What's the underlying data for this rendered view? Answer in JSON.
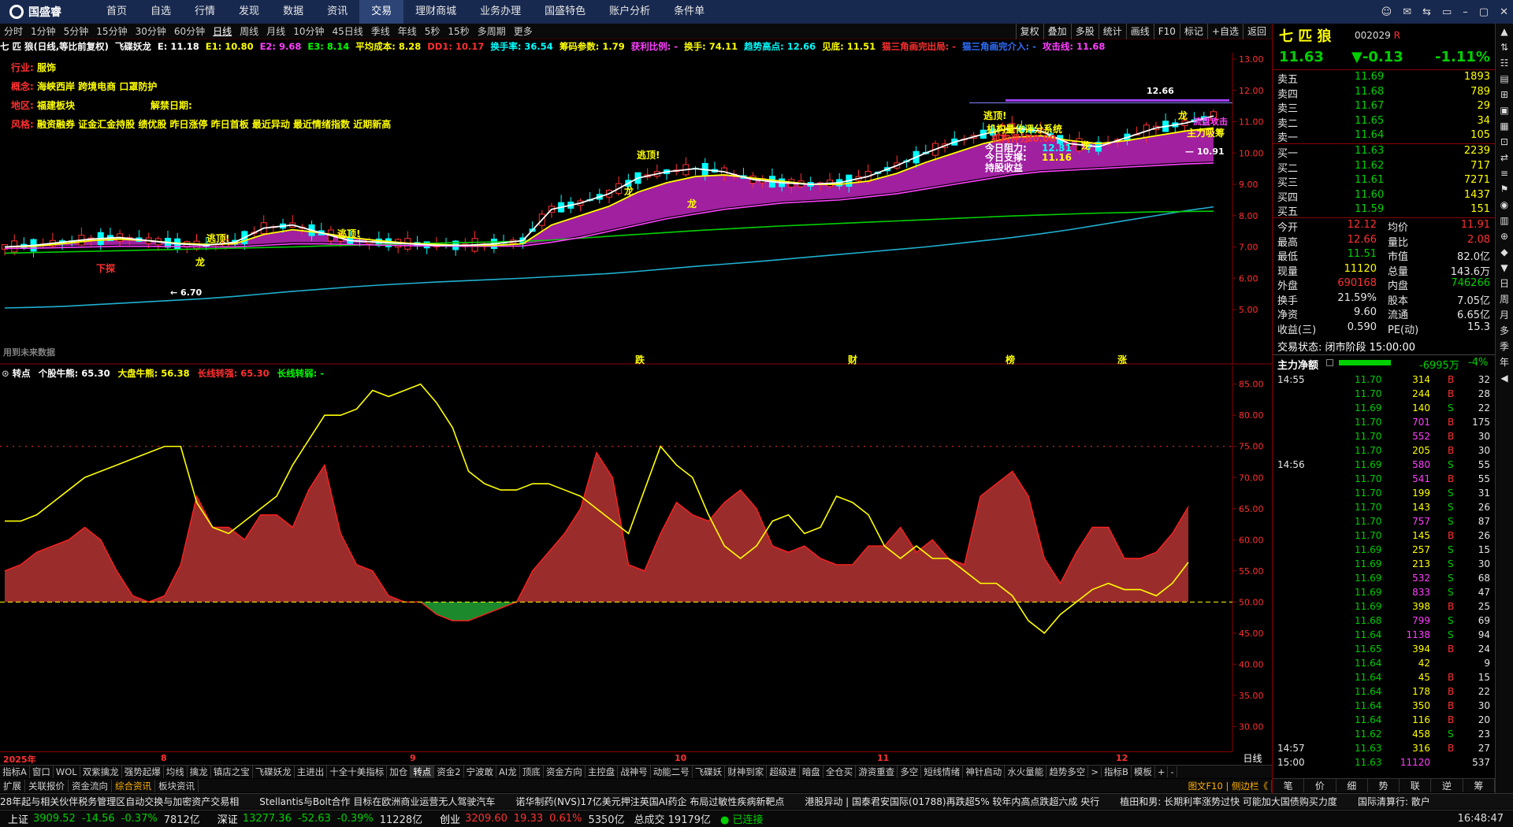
{
  "app": {
    "logo": "国盛睿"
  },
  "topnav": [
    "首页",
    "自选",
    "行情",
    "发现",
    "数据",
    "资讯",
    "交易",
    "理财商城",
    "业务办理",
    "国盛特色",
    "账户分析",
    "条件单"
  ],
  "topnav_active": 6,
  "window_controls": [
    "☺",
    "✉",
    "⇆",
    "▭",
    "–",
    "▢",
    "✕"
  ],
  "periods": [
    "分时",
    "1分钟",
    "5分钟",
    "15分钟",
    "30分钟",
    "60分钟",
    "日线",
    "周线",
    "月线",
    "10分钟",
    "45日线",
    "季线",
    "年线",
    "5秒",
    "15秒",
    "多周期",
    "更多"
  ],
  "period_active": 6,
  "right_tools": [
    "复权",
    "叠加",
    "多股",
    "统计",
    "画线",
    "F10",
    "标记",
    "+自选",
    "返回"
  ],
  "indicators": [
    {
      "t": "七 匹 狼(日线,等比前复权)",
      "c": "#ffffff"
    },
    {
      "t": "飞碟妖龙",
      "c": "#ffffff"
    },
    {
      "t": "E: 11.18",
      "c": "#ffffff"
    },
    {
      "t": "E1: 10.80",
      "c": "#ffff00"
    },
    {
      "t": "E2: 9.68",
      "c": "#ff40ff"
    },
    {
      "t": "E3: 8.14",
      "c": "#00ff00"
    },
    {
      "t": "平均成本: 8.28",
      "c": "#ffff00"
    },
    {
      "t": "DD1: 10.17",
      "c": "#ff3030"
    },
    {
      "t": "换手率: 36.54",
      "c": "#00ffff"
    },
    {
      "t": "筹码参数: 1.79",
      "c": "#ffff00"
    },
    {
      "t": "获利比例: -",
      "c": "#ff40ff"
    },
    {
      "t": "换手: 74.11",
      "c": "#ffff00"
    },
    {
      "t": "趋势高点: 12.66",
      "c": "#00ffff"
    },
    {
      "t": "见底: 11.51",
      "c": "#ffff00"
    },
    {
      "t": "猫三角画完出局: -",
      "c": "#ff3030"
    },
    {
      "t": "猫三角画完介入: -",
      "c": "#3070ff"
    },
    {
      "t": "攻击线: 11.68",
      "c": "#ff40ff"
    }
  ],
  "info": [
    {
      "k": "行业:",
      "v": "服饰"
    },
    {
      "k": "概念:",
      "v": "海峡西岸 跨境电商 口罩防护"
    },
    {
      "k": "地区:",
      "v": "福建板块",
      "k2": "解禁日期:"
    },
    {
      "k": "风格:",
      "v": "融资融券 证金汇金持股 绩优股 昨日涨停 昨日首板 最近异动 最近情绪指数 近期新高"
    }
  ],
  "main_axis": [
    "13.00",
    "12.00",
    "11.00",
    "10.00",
    "9.00",
    "8.00",
    "7.00",
    "6.00",
    "5.00"
  ],
  "chart_annotations": {
    "high": "12.66",
    "low": "6.70",
    "last": "10.91",
    "flag": "下探",
    "escape": "逃顶!",
    "dragon": "龙",
    "main_buy": "主力吸筹",
    "rating": "机构量化评分系统",
    "score_label": "机构评分:",
    "score": "70.00",
    "today_res": "今日阻力:",
    "today_res_v": "12.31",
    "today_sup": "今日支撑:",
    "today_sup_v": "11.16",
    "hold": "持股收益",
    "future": "用到未来数据",
    "tags": [
      "跌",
      "财",
      "榜",
      "涨"
    ],
    "rd": "流盘攻击"
  },
  "sub_title": [
    {
      "t": "转点",
      "c": "#ffffff"
    },
    {
      "t": "个股牛熊: 65.30",
      "c": "#ffffff"
    },
    {
      "t": "大盘牛熊: 56.38",
      "c": "#ffff00"
    },
    {
      "t": "长线转强: 65.30",
      "c": "#ff3030"
    },
    {
      "t": "长线转弱: -",
      "c": "#00ff00"
    }
  ],
  "sub_axis": [
    "85.00",
    "80.00",
    "75.00",
    "70.00",
    "65.00",
    "60.00",
    "55.00",
    "50.00",
    "45.00",
    "40.00",
    "35.00",
    "30.00"
  ],
  "xaxis": [
    {
      "t": "2025年",
      "x": 4
    },
    {
      "t": "8",
      "x": 204
    },
    {
      "t": "9",
      "x": 520
    },
    {
      "t": "10",
      "x": 856
    },
    {
      "t": "11",
      "x": 1113
    },
    {
      "t": "12",
      "x": 1416
    }
  ],
  "riqi": "日线",
  "tabs1": [
    "指标A",
    "窗口",
    "WOL",
    "双紫擒龙",
    "强势起爆",
    "均线",
    "擒龙",
    "镇店之宝",
    "飞碟妖龙",
    "主进出",
    "十全十美指标",
    "加仓",
    "转点",
    "资金2",
    "宁波敢",
    "AI龙",
    "顶底",
    "资金方向",
    "主控盘",
    "战神号",
    "动能二号",
    "飞碟妖",
    "财神到家",
    "超级进",
    "暗盘",
    "全仓买",
    "游资重查",
    "多空",
    "短线情绪",
    "神针启动",
    "水火量能",
    "趋势多空",
    ">",
    "指标B",
    "模板",
    "+",
    "-"
  ],
  "tabs1_active": 12,
  "tabs2": [
    "扩展",
    "关联报价",
    "资金流向",
    "综合资讯",
    "板块资讯"
  ],
  "tabs2_active": 3,
  "tabs2_right": "图文F10 | 侧边栏《",
  "news": [
    "28年起与相关伙伴税务管理区自动交换与加密资产交易相",
    "Stellantis与Bolt合作 目标在欧洲商业运营无人驾驶汽车",
    "诺华制药(NVS)17亿美元押注英国AI药企 布局过敏性疾病新靶点",
    "港股异动 | 国泰君安国际(01788)再跌超5% 较年内高点跌超六成 央行",
    "植田和男: 长期利率涨势过快 可能加大国债购买力度",
    "国际清算行: 散户"
  ],
  "status": [
    {
      "n": "上证",
      "v": "3909.52",
      "d": "-14.56",
      "p": "-0.37%",
      "a": "7812亿",
      "c": "g"
    },
    {
      "n": "深证",
      "v": "13277.36",
      "d": "-52.63",
      "p": "-0.39%",
      "a": "11228亿",
      "c": "g"
    },
    {
      "n": "创业",
      "v": "3209.60",
      "d": "19.33",
      "p": "0.61%",
      "a": "5350亿",
      "c": "r"
    }
  ],
  "status_total": "总成交 19179亿",
  "status_conn": "已连接",
  "status_time": "16:48:47",
  "stock": {
    "name": "七 匹 狼",
    "code": "002029",
    "tag": "R",
    "price": "11.63",
    "change": "▼-0.13",
    "pct": "-1.11%"
  },
  "asks": [
    {
      "l": "卖五",
      "p": "11.69",
      "v": "1893"
    },
    {
      "l": "卖四",
      "p": "11.68",
      "v": "789"
    },
    {
      "l": "卖三",
      "p": "11.67",
      "v": "29"
    },
    {
      "l": "卖二",
      "p": "11.65",
      "v": "34"
    },
    {
      "l": "卖一",
      "p": "11.64",
      "v": "105"
    }
  ],
  "bids": [
    {
      "l": "买一",
      "p": "11.63",
      "v": "2239"
    },
    {
      "l": "买二",
      "p": "11.62",
      "v": "717"
    },
    {
      "l": "买三",
      "p": "11.61",
      "v": "7271"
    },
    {
      "l": "买四",
      "p": "11.60",
      "v": "1437"
    },
    {
      "l": "买五",
      "p": "11.59",
      "v": "151"
    }
  ],
  "stats": [
    {
      "l": "今开",
      "v": "12.12",
      "c": "r",
      "l2": "均价",
      "v2": "11.91",
      "c2": "r"
    },
    {
      "l": "最高",
      "v": "12.66",
      "c": "r",
      "l2": "量比",
      "v2": "2.08",
      "c2": "r"
    },
    {
      "l": "最低",
      "v": "11.51",
      "c": "g",
      "l2": "市值",
      "v2": "82.0亿",
      "c2": "w"
    },
    {
      "l": "现量",
      "v": "11120",
      "c": "y",
      "l2": "总量",
      "v2": "143.6万",
      "c2": "w"
    },
    {
      "l": "外盘",
      "v": "690168",
      "c": "r",
      "l2": "内盘",
      "v2": "746266",
      "c2": "g"
    },
    {
      "l": "换手",
      "v": "21.59%",
      "c": "w",
      "l2": "股本",
      "v2": "7.05亿",
      "c2": "w"
    },
    {
      "l": "净资",
      "v": "9.60",
      "c": "w",
      "l2": "流通",
      "v2": "6.65亿",
      "c2": "w"
    },
    {
      "l": "收益(三)",
      "v": "0.590",
      "c": "w",
      "l2": "PE(动)",
      "v2": "15.3",
      "c2": "w"
    }
  ],
  "trade_state": "交易状态: 闭市阶段 15:00:00",
  "main_net": {
    "l": "主力净额",
    "v": "-6995万",
    "p": "-4%",
    "fill": 0.8
  },
  "ticks": [
    {
      "t": "14:55",
      "p": "11.70",
      "v": "314",
      "s": "B",
      "n": "32"
    },
    {
      "t": "",
      "p": "11.70",
      "v": "244",
      "s": "B",
      "n": "28"
    },
    {
      "t": "",
      "p": "11.69",
      "v": "140",
      "s": "S",
      "n": "22"
    },
    {
      "t": "",
      "p": "11.70",
      "v": "701",
      "s": "B",
      "n": "175"
    },
    {
      "t": "",
      "p": "11.70",
      "v": "552",
      "s": "B",
      "n": "30"
    },
    {
      "t": "",
      "p": "11.70",
      "v": "205",
      "s": "B",
      "n": "30"
    },
    {
      "t": "14:56",
      "p": "11.69",
      "v": "580",
      "s": "S",
      "n": "55"
    },
    {
      "t": "",
      "p": "11.70",
      "v": "541",
      "s": "B",
      "n": "55"
    },
    {
      "t": "",
      "p": "11.70",
      "v": "199",
      "s": "S",
      "n": "31"
    },
    {
      "t": "",
      "p": "11.70",
      "v": "143",
      "s": "S",
      "n": "26"
    },
    {
      "t": "",
      "p": "11.70",
      "v": "757",
      "s": "S",
      "n": "87"
    },
    {
      "t": "",
      "p": "11.70",
      "v": "145",
      "s": "B",
      "n": "26"
    },
    {
      "t": "",
      "p": "11.69",
      "v": "257",
      "s": "S",
      "n": "15"
    },
    {
      "t": "",
      "p": "11.69",
      "v": "213",
      "s": "S",
      "n": "30"
    },
    {
      "t": "",
      "p": "11.69",
      "v": "532",
      "s": "S",
      "n": "68"
    },
    {
      "t": "",
      "p": "11.69",
      "v": "833",
      "s": "S",
      "n": "47"
    },
    {
      "t": "",
      "p": "11.69",
      "v": "398",
      "s": "B",
      "n": "25"
    },
    {
      "t": "",
      "p": "11.68",
      "v": "799",
      "s": "S",
      "n": "69"
    },
    {
      "t": "",
      "p": "11.64",
      "v": "1138",
      "s": "S",
      "n": "94"
    },
    {
      "t": "",
      "p": "11.65",
      "v": "394",
      "s": "B",
      "n": "24"
    },
    {
      "t": "",
      "p": "11.64",
      "v": "42",
      "s": "",
      "n": "9"
    },
    {
      "t": "",
      "p": "11.64",
      "v": "45",
      "s": "B",
      "n": "15"
    },
    {
      "t": "",
      "p": "11.64",
      "v": "178",
      "s": "B",
      "n": "22"
    },
    {
      "t": "",
      "p": "11.64",
      "v": "350",
      "s": "B",
      "n": "30"
    },
    {
      "t": "",
      "p": "11.64",
      "v": "116",
      "s": "B",
      "n": "20"
    },
    {
      "t": "",
      "p": "11.62",
      "v": "458",
      "s": "S",
      "n": "23"
    },
    {
      "t": "14:57",
      "p": "11.63",
      "v": "316",
      "s": "B",
      "n": "27"
    },
    {
      "t": "15:00",
      "p": "11.63",
      "v": "11120",
      "s": "",
      "n": "537"
    }
  ],
  "right_bottom_tabs": [
    "笔",
    "价",
    "细",
    "势",
    "联",
    "逆",
    "筹"
  ],
  "side_tabs": [
    "▲",
    "⇅",
    "☷",
    "▤",
    "⊞",
    "▣",
    "▦",
    "⊡",
    "⇄",
    "≡",
    "⚑",
    "◉",
    "▥",
    "⊕",
    "◆",
    "▼",
    "日",
    "周",
    "月",
    "多",
    "季",
    "年",
    "◀"
  ],
  "colors": {
    "up": "#ff3030",
    "down": "#00d000",
    "text": "#c8c8c8",
    "yellow": "#ffff00",
    "nav": "#18294f"
  },
  "chart_data": [
    {
      "type": "line",
      "name": "main-kline",
      "ylim": [
        5,
        13
      ],
      "yticks": [
        13,
        12,
        11,
        10,
        9,
        8,
        7,
        6,
        5
      ],
      "series": [
        {
          "name": "E",
          "values": [
            7.0,
            7.05,
            7.15,
            7.25,
            7.3,
            7.2,
            7.1,
            7.05,
            7.15,
            7.6,
            7.7,
            7.45,
            7.2,
            7.15,
            7.1,
            7.05,
            7.05,
            7.1,
            7.2,
            8.2,
            8.4,
            8.7,
            9.2,
            9.4,
            9.5,
            9.4,
            9.15,
            9.05,
            9.0,
            9.05,
            9.25,
            9.6,
            10.0,
            10.35,
            10.6,
            10.8,
            10.7,
            10.3,
            10.2,
            10.5,
            10.8,
            10.95,
            11.18
          ]
        },
        {
          "name": "E1",
          "values": [
            7.0,
            7.02,
            7.1,
            7.2,
            7.25,
            7.2,
            7.12,
            7.08,
            7.1,
            7.4,
            7.55,
            7.45,
            7.3,
            7.2,
            7.12,
            7.08,
            7.05,
            7.05,
            7.1,
            7.7,
            8.0,
            8.3,
            8.75,
            9.05,
            9.25,
            9.3,
            9.2,
            9.1,
            9.0,
            9.0,
            9.1,
            9.35,
            9.7,
            10.0,
            10.3,
            10.5,
            10.55,
            10.4,
            10.3,
            10.4,
            10.55,
            10.7,
            10.8
          ]
        },
        {
          "name": "E2",
          "values": [
            6.95,
            6.96,
            6.98,
            7.0,
            7.02,
            7.02,
            7.01,
            7.0,
            7.0,
            7.05,
            7.1,
            7.1,
            7.08,
            7.06,
            7.04,
            7.03,
            7.02,
            7.02,
            7.03,
            7.15,
            7.3,
            7.5,
            7.7,
            7.9,
            8.05,
            8.2,
            8.3,
            8.4,
            8.45,
            8.5,
            8.6,
            8.7,
            8.85,
            9.0,
            9.15,
            9.3,
            9.4,
            9.45,
            9.5,
            9.55,
            9.6,
            9.65,
            9.68
          ]
        },
        {
          "name": "E3",
          "values": [
            6.8,
            6.82,
            6.84,
            6.86,
            6.88,
            6.9,
            6.92,
            6.94,
            6.96,
            6.98,
            7.0,
            7.03,
            7.05,
            7.08,
            7.1,
            7.12,
            7.14,
            7.16,
            7.18,
            7.22,
            7.28,
            7.34,
            7.4,
            7.46,
            7.52,
            7.57,
            7.62,
            7.67,
            7.71,
            7.75,
            7.79,
            7.83,
            7.87,
            7.91,
            7.95,
            7.99,
            8.02,
            8.05,
            8.08,
            8.1,
            8.12,
            8.13,
            8.14
          ]
        },
        {
          "name": "平均成本",
          "values": [
            5.05,
            5.07,
            5.1,
            5.15,
            5.2,
            5.25,
            5.3,
            5.35,
            5.42,
            5.5,
            5.58,
            5.65,
            5.72,
            5.78,
            5.83,
            5.88,
            5.92,
            5.96,
            6.0,
            6.05,
            6.1,
            6.15,
            6.22,
            6.3,
            6.38,
            6.45,
            6.52,
            6.6,
            6.68,
            6.76,
            6.84,
            6.92,
            7.0,
            7.1,
            7.2,
            7.3,
            7.42,
            7.55,
            7.7,
            7.85,
            8.0,
            8.15,
            8.28
          ]
        }
      ]
    },
    {
      "type": "area",
      "name": "sub-indicator",
      "ylim": [
        26,
        88
      ],
      "yticks": [
        85,
        80,
        75,
        70,
        65,
        60,
        55,
        50,
        45,
        40,
        35,
        30
      ],
      "baseline": 50,
      "series": [
        {
          "name": "个股牛熊",
          "values": [
            55,
            56,
            58,
            59,
            60,
            62,
            60,
            55,
            51,
            50,
            51,
            56,
            67,
            62,
            62,
            60,
            64,
            64,
            62,
            68,
            72,
            61,
            56,
            55,
            51,
            50,
            50,
            48,
            47,
            47,
            48,
            49,
            50,
            55,
            58,
            61,
            65,
            74,
            70,
            56,
            55,
            61,
            66,
            64,
            63,
            66,
            68,
            65,
            59,
            58,
            59,
            57,
            56,
            56,
            59,
            59,
            62,
            58,
            60,
            57,
            56,
            67,
            69,
            71,
            67,
            57,
            53,
            58,
            62,
            62,
            57,
            57,
            58,
            61,
            65.3
          ]
        },
        {
          "name": "大盘牛熊",
          "values": [
            63,
            63,
            64,
            66,
            68,
            70,
            71,
            72,
            73,
            74,
            75,
            75,
            66,
            62,
            61,
            63,
            65,
            67,
            72,
            76,
            80,
            80,
            81,
            84,
            83,
            84,
            85,
            82,
            78,
            71,
            69,
            68,
            68,
            69,
            69,
            68,
            67,
            65,
            63,
            61,
            68,
            75,
            72,
            70,
            64,
            59,
            57,
            59,
            63,
            64,
            61,
            62,
            67,
            66,
            64,
            59,
            57,
            59,
            57,
            57,
            55,
            53,
            53,
            51,
            47,
            45,
            48,
            50,
            52,
            53,
            52,
            52,
            51,
            53,
            56.38
          ]
        }
      ]
    }
  ]
}
